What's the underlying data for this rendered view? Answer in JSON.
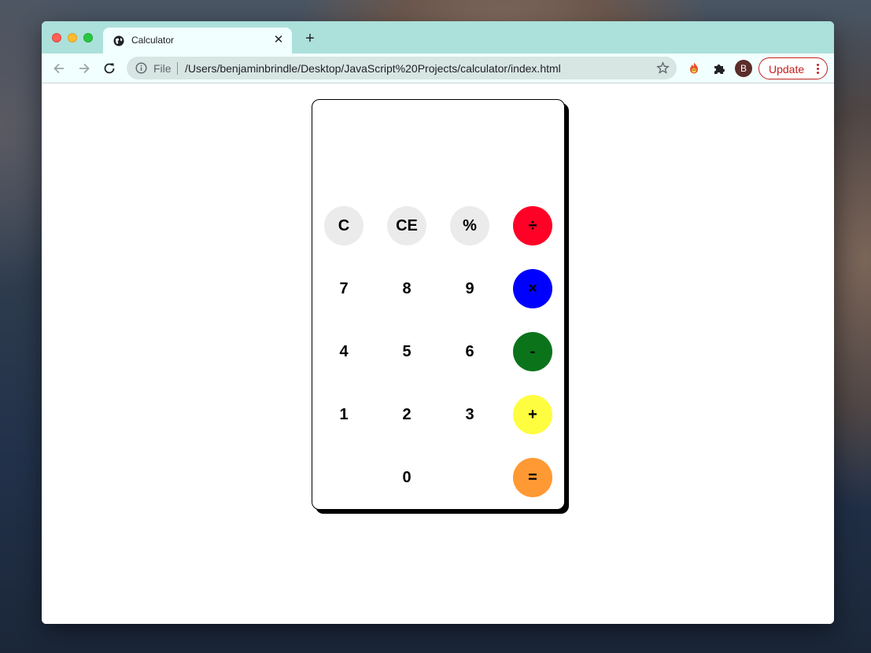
{
  "browser": {
    "tab": {
      "title": "Calculator",
      "close": "✕"
    },
    "new_tab": "+",
    "address_bar": {
      "scheme_label": "File",
      "url": "/Users/benjaminbrindle/Desktop/JavaScript%20Projects/calculator/index.html"
    },
    "avatar_letter": "B",
    "update_label": "Update",
    "icons": [
      "back-arrow-icon",
      "forward-arrow-icon",
      "reload-icon",
      "info-icon",
      "star-icon",
      "extension-fire-icon",
      "puzzle-icon",
      "kebab-menu-icon"
    ]
  },
  "calculator": {
    "display": "",
    "keys": {
      "clear": "C",
      "clear_entry": "CE",
      "percent": "%",
      "divide": "÷",
      "seven": "7",
      "eight": "8",
      "nine": "9",
      "multiply": "×",
      "four": "4",
      "five": "5",
      "six": "6",
      "subtract": "-",
      "one": "1",
      "two": "2",
      "three": "3",
      "add": "+",
      "zero": "0",
      "equals": "="
    },
    "colors": {
      "function_keys": "#ebebeb",
      "divide": "#ff0026",
      "multiply": "#0000ff",
      "subtract": "#0b741b",
      "add": "#fffd3f",
      "equals": "#ff9933"
    }
  }
}
